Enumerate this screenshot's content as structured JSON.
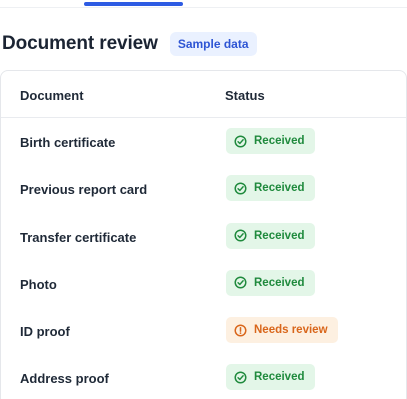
{
  "header": {
    "title": "Document review",
    "badge": "Sample data"
  },
  "table": {
    "columns": [
      "Document",
      "Status"
    ],
    "rows": [
      {
        "document": "Birth certificate",
        "status": "Received",
        "status_type": "received"
      },
      {
        "document": "Previous report card",
        "status": "Received",
        "status_type": "received"
      },
      {
        "document": "Transfer certificate",
        "status": "Received",
        "status_type": "received"
      },
      {
        "document": "Photo",
        "status": "Received",
        "status_type": "received"
      },
      {
        "document": "ID proof",
        "status": "Needs review",
        "status_type": "review"
      },
      {
        "document": "Address proof",
        "status": "Received",
        "status_type": "received"
      }
    ]
  },
  "colors": {
    "accent": "#2d5be3",
    "received_text": "#1f8a3d",
    "received_bg": "#e3f6e8",
    "review_text": "#d9661b",
    "review_bg": "#fdf0e1"
  },
  "icons": {
    "received": "check-circle-icon",
    "review": "alert-circle-icon"
  }
}
